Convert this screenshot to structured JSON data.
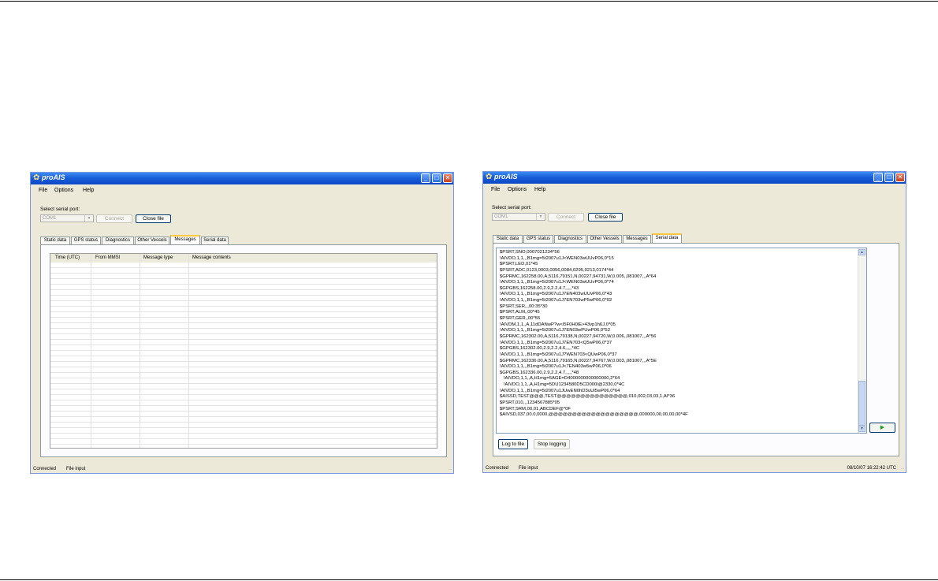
{
  "app_title": "proAIS",
  "menu": [
    "File",
    "Options",
    "Help"
  ],
  "serial_port": {
    "label": "Select serial port:",
    "selected": "COM1",
    "connect_label": "Connect",
    "close_file_label": "Close file"
  },
  "tabs": [
    "Static data",
    "GPS status",
    "Diagnostics",
    "Other Vessels",
    "Messages",
    "Serial data"
  ],
  "left_window": {
    "active_tab": "Messages",
    "columns": [
      "Time (UTC)",
      "From MMSI",
      "Message type",
      "Message contents"
    ],
    "status": {
      "connection": "Connected",
      "input": "File input",
      "grip": "..."
    }
  },
  "right_window": {
    "active_tab": "Serial data",
    "serial_lines": [
      "$PSRT,SNO,0007021234*56",
      "!AIVDO,1,1,,,B1mg=5t2007u1J<WEN03wUUvP06,0*15",
      "$PSRT,LED,01*45",
      "$PSRT,ADC,0123,0003,0056,0084,0295,0213,0174*44",
      "$GPRMC,162258.00,A,5116,79151,N,00227,94731,W,0.005,,081007,,,A*64",
      "!AIVDO,1,1,,,B1mg=5t2007u1J<WEN03wUUvP06,0*74",
      "$GPGBS,162258.00,2.9,2.2,4.7,,,,,*43",
      "!AIVDO,1,1,,,B1mg=5t2007u1J7EN403wUUvP06,0*43",
      "!AIVDO,1,1,,,B1mg=5t2007u1J7EN703wP5wP06,0*02",
      "$PSRT,SER,,,00:35*30",
      "$PSRT,ALM,,00*45",
      "$PSRT,GER,,00*55",
      "!AIVDM,1,1,,A,11dDANwP?w<l5F0H0lE>43vp1h6J,0*05",
      "!AIVDO,1,1,,,B1mg=5t2007u1J7EN03wPUwP06,0*52",
      "$GPRMC,162302.00,A,5116,79138,N,00227,94720,W,0.006,,081007,,,A*56",
      "!AIVDO,1,1,,,B1mg=5t2007u1J7EN703<Q5wP06,0*37",
      "$GPGBS,162302.00,2.9,2.2,4.6,,,,,*4C",
      "!AIVDO,1,1,,,B1mg=5t2007u1J?WEN703<QUwP06,0*37",
      "$GPRMC,162336.00,A,5116,79165,N,00227,94767,W,0.003,,081007,,,A*5E",
      "!AIVDO,1,1,,,B1mg=5t2007u1J<7EN403w5wP06,0*06",
      "$GPGBS,162336.00,2.9,2.2,4.7,,,,,*48",
      "   !AIVDO,1,1,,A,H1mg=5AGE=D4000000000000000,2*64",
      "   !AIVDO,1,1,,A,H1mg=5DU1234580D5CD000l@2330,0*4C",
      "!AIVDO,1,1,,,B1mg=5t2007u1JUwEN0hD3uUl5wP06,0*64",
      "$AISSD,TEST@@@,TEST@@@@@@@@@@@@@@@,010,002,03,03,1,AI*36",
      "$PSRT,010,,,1234567885*05",
      "$PSRT,SRM,00,01,ABCDEF@*0F",
      "$AIVSD,037,00.0,0000,@@@@@@@@@@@@@@@@@@@,000000,00,00,00,00*4F"
    ],
    "log_to_file_label": "Log to file",
    "stop_logging_label": "Stop logging",
    "send_icon": "play-arrow-icon",
    "status": {
      "connection": "Connected",
      "input": "File input",
      "datetime": "08/10/07  16:22:42 UTC",
      "grip": "..."
    }
  }
}
